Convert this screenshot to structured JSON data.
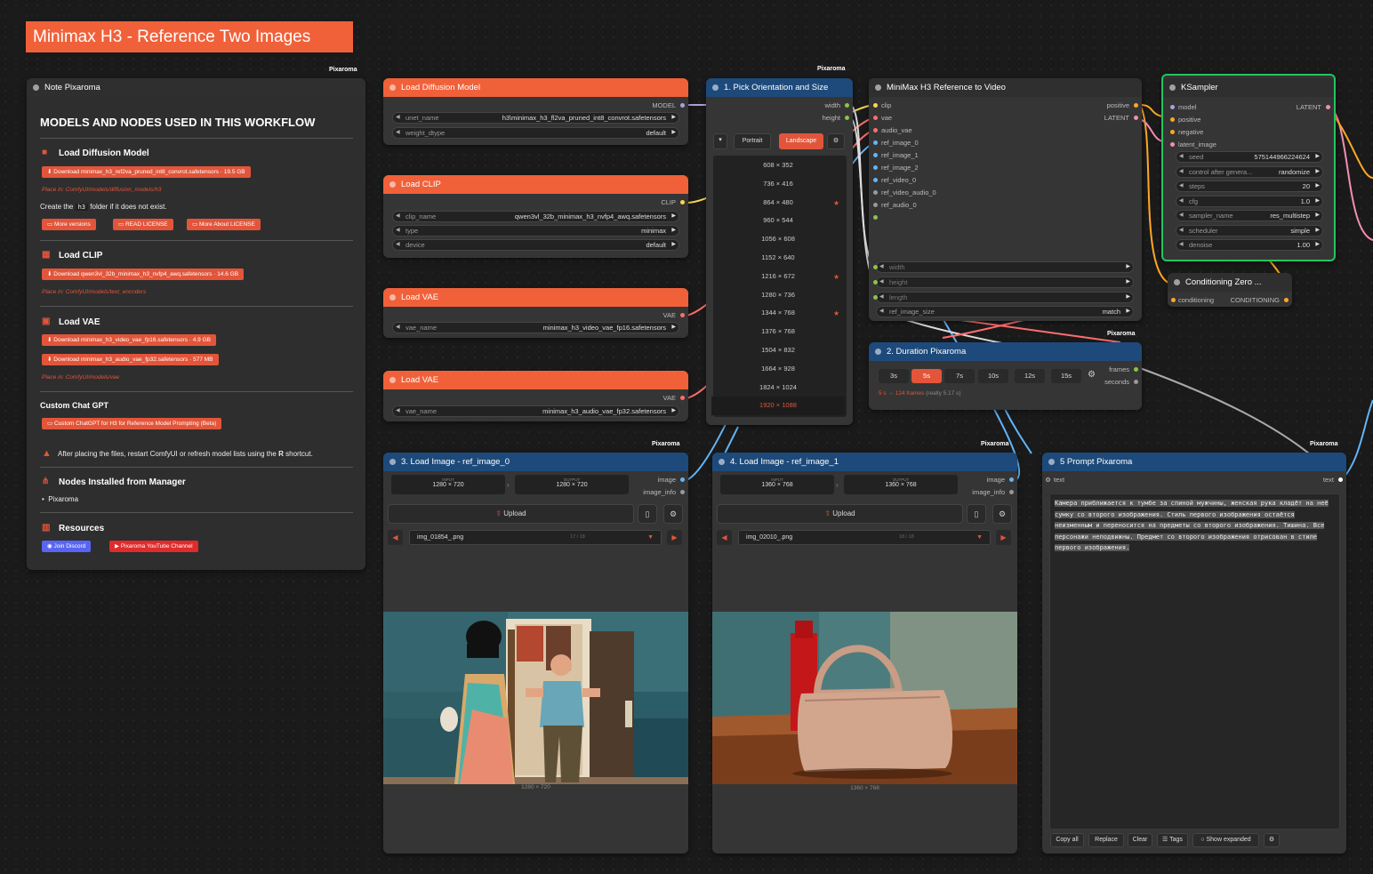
{
  "banner": {
    "title": "Minimax H3 - Reference Two Images"
  },
  "brand": "Pixaroma",
  "note": {
    "header": "Note Pixaroma",
    "heading": "MODELS AND NODES USED IN THIS WORKFLOW",
    "s1_title": "Load Diffusion Model",
    "s1_download": "Download minimax_h3_ref2va_pruned_int8_convrot.safetensors",
    "s1_size": "19.5 GB",
    "s1_place": "Place in: ComfyUI/models/diffusion_models/h3",
    "create_pre": "Create the",
    "create_code": "h3",
    "create_post": "folder if it does not exist.",
    "more_versions": "More versions",
    "read_license": "READ LICENSE",
    "more_license": "More About LICENSE",
    "s2_title": "Load CLIP",
    "s2_download": "Download qwen3vl_32b_minimax_h3_nvfp4_awq.safetensors",
    "s2_size": "14.6 GB",
    "s2_place": "Place in: ComfyUI/models/text_encoders",
    "s3_title": "Load VAE",
    "s3_download1": "Download minimax_h3_video_vae_fp16.safetensors",
    "s3_size1": "4.9 GB",
    "s3_download2": "Download minimax_h3_audio_vae_fp32.safetensors",
    "s3_size2": "577 MB",
    "s3_place": "Place in: ComfyUI/models/vae",
    "gpt_title": "Custom Chat GPT",
    "gpt_btn": "Custom ChatGPT for H3 for Reference Model Prompting (Beta)",
    "warning_pre": "After placing the files, restart ComfyUI or refresh model lists using the",
    "warning_key": "R",
    "warning_post": "shortcut.",
    "nodes_title": "Nodes Installed from Manager",
    "nodes_item": "Pixaroma",
    "res_title": "Resources",
    "discord": "Join Discord",
    "youtube": "Pixaroma YouTube Channel"
  },
  "load_diffusion": {
    "header": "Load Diffusion Model",
    "out": "MODEL",
    "unet_label": "unet_name",
    "unet_value": "h3\\minimax_h3_fl2va_pruned_int8_convrot.safetensors",
    "dtype_label": "weight_dtype",
    "dtype_value": "default"
  },
  "load_clip": {
    "header": "Load CLIP",
    "out": "CLIP",
    "name_label": "clip_name",
    "name_value": "qwen3vl_32b_minimax_h3_nvfp4_awq.safetensors",
    "type_label": "type",
    "type_value": "minimax",
    "device_label": "device",
    "device_value": "default"
  },
  "load_vae1": {
    "header": "Load VAE",
    "out": "VAE",
    "label": "vae_name",
    "value": "minimax_h3_video_vae_fp16.safetensors"
  },
  "load_vae2": {
    "header": "Load VAE",
    "out": "VAE",
    "label": "vae_name",
    "value": "minimax_h3_audio_vae_fp32.safetensors"
  },
  "pick": {
    "header": "1. Pick Orientation and Size",
    "out_width": "width",
    "out_height": "height",
    "portrait": "Portrait",
    "landscape": "Landscape",
    "resolutions": [
      "608 × 352",
      "736 × 416",
      "864 × 480",
      "960 × 544",
      "1056 × 608",
      "1152 × 640",
      "1216 × 672",
      "1280 × 736",
      "1344 × 768",
      "1376 × 768",
      "1504 × 832",
      "1664 × 928",
      "1824 × 1024",
      "1920 × 1088"
    ]
  },
  "minimax": {
    "header": "MiniMax H3 Reference to Video",
    "inputs": [
      "clip",
      "vae",
      "audio_vae",
      "ref_image_0",
      "ref_image_1",
      "ref_image_2",
      "ref_video_0",
      "ref_video_audio_0",
      "ref_audio_0"
    ],
    "out_positive": "positive",
    "out_latent": "LATENT",
    "w_width": "width",
    "w_height": "height",
    "w_length": "length",
    "ref_size_label": "ref_image_size",
    "ref_size_value": "match"
  },
  "ksampler": {
    "header": "KSampler",
    "inputs": [
      "model",
      "positive",
      "negative",
      "latent_image"
    ],
    "out": "LATENT",
    "seed_label": "seed",
    "seed_value": "575144966224624",
    "cag_label": "control after genera...",
    "cag_value": "randomize",
    "steps_label": "steps",
    "steps_value": "20",
    "cfg_label": "cfg",
    "cfg_value": "1.0",
    "sampler_label": "sampler_name",
    "sampler_value": "res_multistep",
    "scheduler_label": "scheduler",
    "scheduler_value": "simple",
    "denoise_label": "denoise",
    "denoise_value": "1.00"
  },
  "cond_zero": {
    "header": "Conditioning Zero ...",
    "in": "conditioning",
    "out": "CONDITIONING"
  },
  "duration": {
    "header": "2. Duration Pixaroma",
    "options": [
      "3s",
      "5s",
      "7s",
      "10s",
      "12s",
      "15s"
    ],
    "out_frames": "frames",
    "out_seconds": "seconds",
    "info": "5 s → 124 frames",
    "info2": "(really 5.17 s)"
  },
  "img0": {
    "header": "3. Load Image - ref_image_0",
    "out_image": "image",
    "out_info": "image_info",
    "input_label": "INPUT",
    "input_value": "1280 × 720",
    "output_label": "OUTPUT",
    "output_value": "1280 × 720",
    "upload": "Upload",
    "file": "img_01854_.png",
    "counter": "17 / 18",
    "caption": "1280 × 720"
  },
  "img1": {
    "header": "4. Load Image - ref_image_1",
    "out_image": "image",
    "out_info": "image_info",
    "input_label": "INPUT",
    "input_value": "1360 × 768",
    "output_label": "OUTPUT",
    "output_value": "1360 × 768",
    "upload": "Upload",
    "file": "img_02010_.png",
    "counter": "18 / 18",
    "caption": "1360 × 768"
  },
  "prompt": {
    "header": "5 Prompt Pixaroma",
    "in": "text",
    "out": "text",
    "text": "Камера приближается к тумбе за спиной мужчины, женская рука кладёт на неё сумку со второго изображения. Стиль первого изображения остаётся неизменным и переносится на предметы со второго изображения. Тишина. Все персонажи неподвижны. Предмет со второго изображения отрисован в стиле первого изображения.",
    "copy_all": "Copy all",
    "replace": "Replace",
    "clear": "Clear",
    "tags": "Tags",
    "show_expanded": "Show expanded"
  },
  "colors": {
    "accent": "#f0613a",
    "blue_header": "#1d4a7a",
    "selected_node": "#22c55e",
    "discord": "#5865f2",
    "youtube": "#e02b2b"
  }
}
